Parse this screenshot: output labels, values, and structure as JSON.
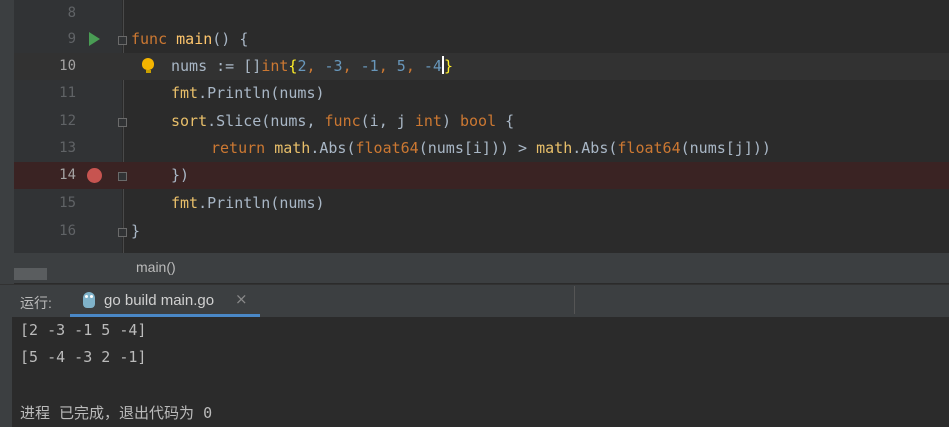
{
  "editor": {
    "lines": [
      {
        "num": "8"
      },
      {
        "num": "9"
      },
      {
        "num": "10"
      },
      {
        "num": "11"
      },
      {
        "num": "12"
      },
      {
        "num": "13"
      },
      {
        "num": "14"
      },
      {
        "num": "15"
      },
      {
        "num": "16"
      }
    ],
    "code": {
      "l9": {
        "kw_func": "func",
        "name": "main",
        "rest": "() {"
      },
      "l10": {
        "a": "nums := []",
        "type": "int",
        "brace_open": "{",
        "n1": "2",
        "s1": ", ",
        "n2": "-3",
        "s2": ", ",
        "n3": "-1",
        "s3": ", ",
        "n4": "5",
        "s4": ", ",
        "n5": "-4",
        "brace_close": "}"
      },
      "l11": {
        "pkg": "fmt",
        "rest": ".Println(nums)"
      },
      "l12": {
        "pkg": "sort",
        "a": ".Slice(nums, ",
        "kw_func": "func",
        "b": "(i, j ",
        "kw_int": "int",
        "c": ") ",
        "kw_bool": "bool",
        "d": " {"
      },
      "l13": {
        "kw_return": "return",
        "sp": " ",
        "pkg1": "math",
        "a": ".Abs(",
        "kw_f1": "float64",
        "b": "(nums[i])) > ",
        "pkg2": "math",
        "c": ".Abs(",
        "kw_f2": "float64",
        "d": "(nums[j]))"
      },
      "l14": {
        "text": "})"
      },
      "l15": {
        "pkg": "fmt",
        "rest": ".Println(nums)"
      },
      "l16": {
        "text": "}"
      }
    }
  },
  "breadcrumb": {
    "text": "main()"
  },
  "run_panel": {
    "label": "运行:",
    "tab_title": "go build main.go",
    "close": "×"
  },
  "console": {
    "lines": [
      "[2 -3 -1 5 -4]",
      "[5 -4 -3 2 -1]",
      "",
      "进程 已完成，退出代码为 0"
    ]
  },
  "icons": {
    "run": "run-gutter-icon",
    "breakpoint": "breakpoint-icon",
    "bulb": "lightbulb-icon",
    "gopher": "go-file-icon"
  },
  "colors": {
    "keyword": "#cc7832",
    "function": "#ffc66d",
    "number": "#6897bb",
    "breakpoint": "#c75450",
    "run": "#499c54"
  }
}
